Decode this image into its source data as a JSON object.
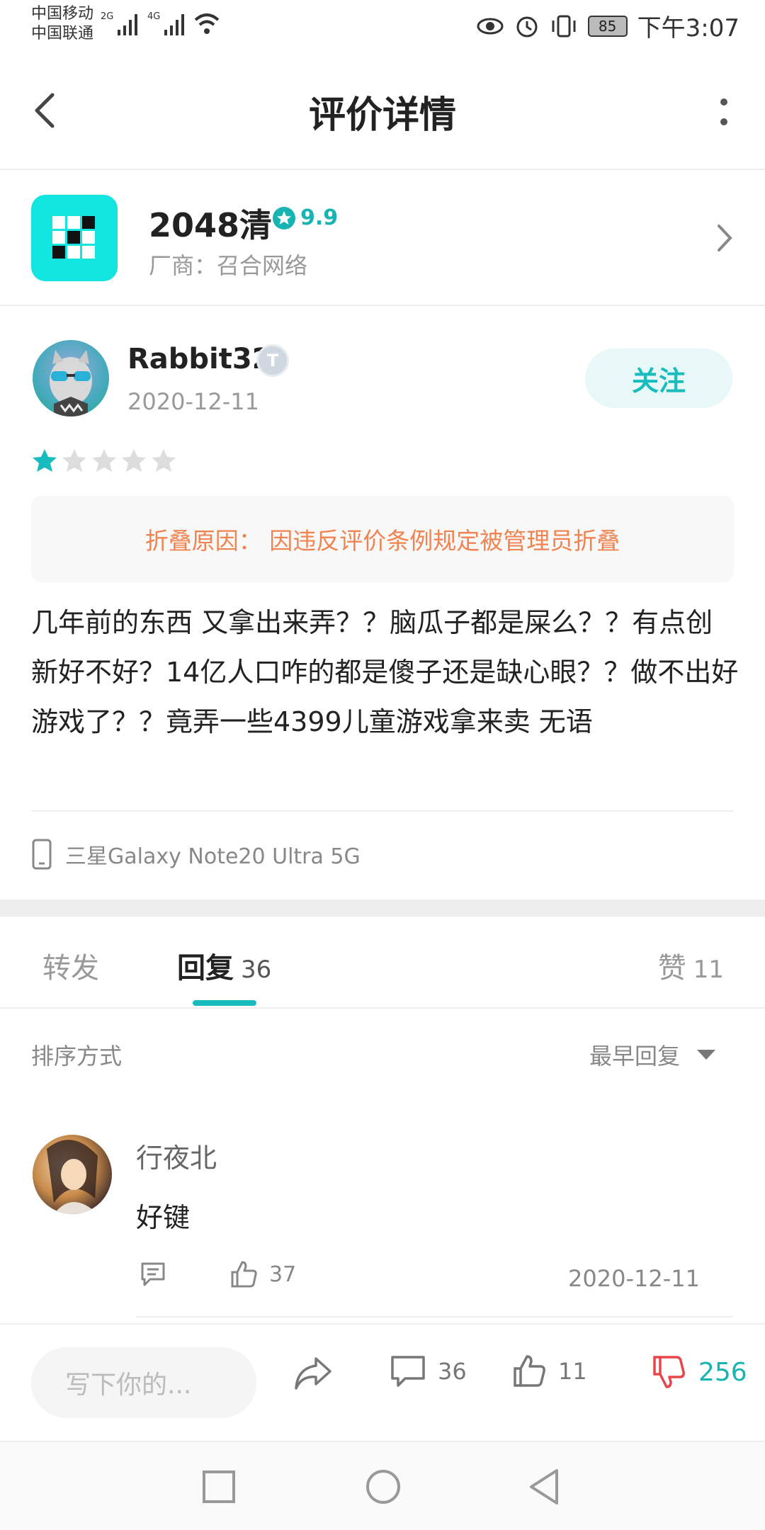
{
  "status_bar": {
    "carrier1": "中国移动",
    "carrier2": "中国联通",
    "net1": "2G",
    "net2": "4G",
    "battery": "85",
    "time": "下午3:07"
  },
  "header": {
    "title": "评价详情"
  },
  "app": {
    "name": "2048清",
    "rating": "9.9",
    "vendor": "厂商：召合网络",
    "icon_color": "#12e4e0"
  },
  "review": {
    "username": "Rabbit32",
    "badge": "T",
    "date": "2020-12-11",
    "follow_label": "关注",
    "stars": 1,
    "stars_total": 5,
    "fold_reason": "折叠原因：  因违反评价条例规定被管理员折叠",
    "content": "几年前的东西 又拿出来弄？？脑瓜子都是屎么？？有点创新好不好？14亿人口咋的都是傻子还是缺心眼？？做不出好游戏了？？竟弄一些4399儿童游戏拿来卖 无语",
    "device": "三星Galaxy Note20 Ultra 5G"
  },
  "tabs": {
    "forward": "转发",
    "reply": "回复",
    "reply_count": "36",
    "like": "赞",
    "like_count": "11"
  },
  "sort": {
    "label": "排序方式",
    "value": "最早回复"
  },
  "replies": [
    {
      "name": "行夜北",
      "text": "好键",
      "likes": "37",
      "date": "2020-12-11"
    }
  ],
  "action_bar": {
    "placeholder": "写下你的...",
    "comment_count": "36",
    "like_count": "11",
    "dislike_count": "256"
  },
  "colors": {
    "accent": "#19bcbc",
    "fold_text": "#f0834f",
    "dislike_red": "#e8454a"
  }
}
